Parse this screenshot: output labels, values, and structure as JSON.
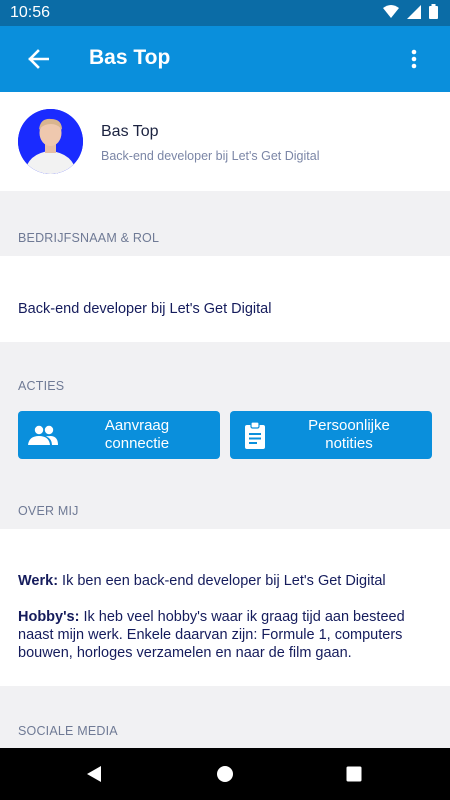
{
  "status_bar": {
    "time": "10:56"
  },
  "app_bar": {
    "title": "Bas Top"
  },
  "profile": {
    "name": "Bas Top",
    "subtitle": "Back-end developer bij Let's Get Digital"
  },
  "company_section": {
    "heading": "BEDRIJFSNAAM & ROL",
    "value": "Back-end developer bij Let's Get Digital"
  },
  "actions_section": {
    "heading": "ACTIES",
    "connect_label_line1": "Aanvraag",
    "connect_label_line2": "connectie",
    "notes_label_line1": "Persoonlijke",
    "notes_label_line2": "notities"
  },
  "about_section": {
    "heading": "OVER MIJ",
    "work_label": "Werk:",
    "work_text": " Ik ben een back-end developer bij Let's Get Digital",
    "hobby_label": "Hobby's:",
    "hobby_text": " Ik heb veel hobby's waar ik graag tijd aan besteed naast mijn werk. Enkele daarvan zijn: Formule 1, computers bouwen, horloges verzamelen en naar de film gaan."
  },
  "social_section": {
    "heading": "SOCIALE MEDIA"
  },
  "colors": {
    "primary": "#0a8fdc",
    "status": "#0b6ca6",
    "text_dark": "#151c5c",
    "muted": "#6f7a95"
  }
}
